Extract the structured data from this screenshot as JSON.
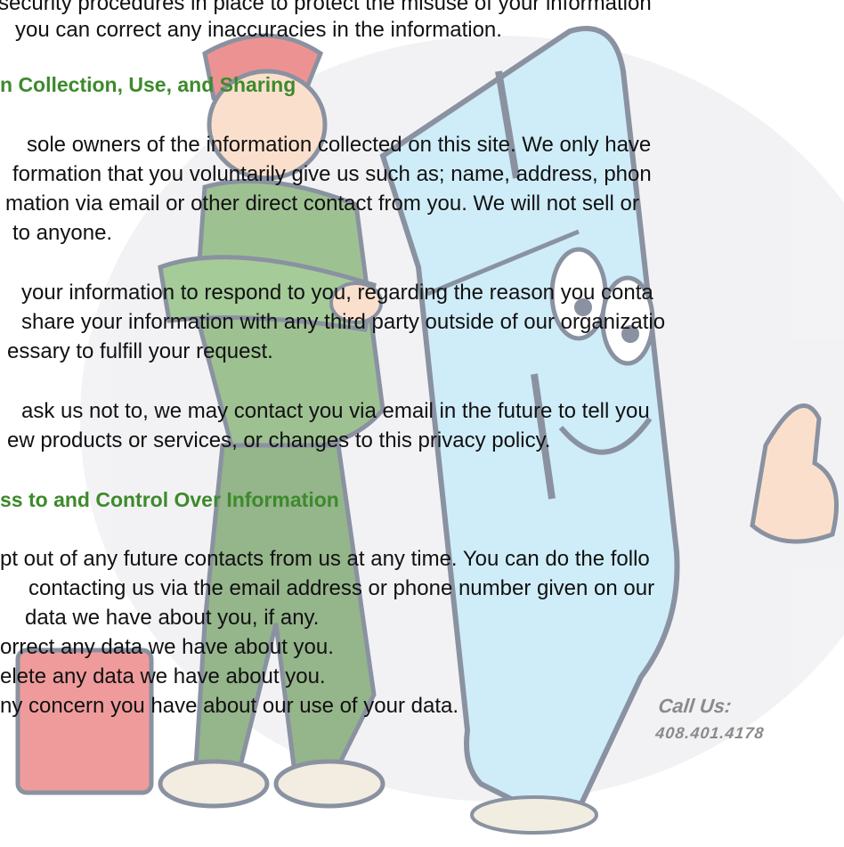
{
  "text": {
    "para0": [
      "security procedures in place to protect the misuse of your information",
      "you can correct any inaccuracies in the information."
    ],
    "heading1": "n Collection, Use, and Sharing",
    "para1": [
      "sole owners of the information collected on this site.  We only have",
      "formation that you voluntarily give us such as; name, address, phon",
      "mation via email or other direct contact from you.  We will not sell or",
      "to anyone."
    ],
    "para2": [
      "your information to respond to you, regarding the reason you conta",
      "share your information with any third party outside of our organizatio",
      "essary to fulfill your request."
    ],
    "para3": [
      "ask us not to, we may contact you via email in the future to tell you",
      "ew products or services, or changes to this privacy policy."
    ],
    "heading2": "ss to and Control Over Information",
    "para4": [
      "pt out of any future contacts from us at any time. You can do the follo",
      "contacting us via the email address or phone number given on our",
      "data we have about you, if any.",
      "orrect any data we have about you.",
      "elete any data we have about you.",
      "ny concern you have about our use of your data."
    ]
  },
  "call_us": {
    "label": "Call Us:",
    "phone": "408.401.4178"
  },
  "colors": {
    "heading": "#3d8a2c",
    "body_text": "#111111",
    "fridge": "#bfe6f7",
    "call_us": "#8a8a8a"
  }
}
